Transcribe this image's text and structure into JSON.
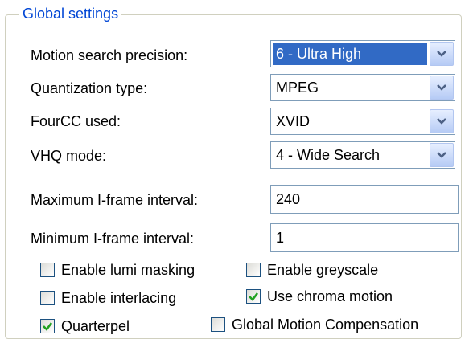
{
  "group": {
    "title": "Global settings"
  },
  "fields": {
    "motion_search": {
      "label": "Motion search precision:",
      "value": "6 - Ultra High"
    },
    "quant_type": {
      "label": "Quantization type:",
      "value": "MPEG"
    },
    "fourcc": {
      "label": "FourCC used:",
      "value": "XVID"
    },
    "vhq": {
      "label": "VHQ mode:",
      "value": "4 - Wide Search"
    },
    "max_iframe": {
      "label": "Maximum I-frame interval:",
      "value": "240"
    },
    "min_iframe": {
      "label": "Minimum I-frame interval:",
      "value": "1"
    }
  },
  "checkboxes": {
    "lumi_masking": {
      "label": "Enable lumi masking",
      "checked": false
    },
    "greyscale": {
      "label": "Enable greyscale",
      "checked": false
    },
    "interlacing": {
      "label": "Enable interlacing",
      "checked": false
    },
    "chroma_motion": {
      "label": "Use chroma motion",
      "checked": true
    },
    "quarterpel": {
      "label": "Quarterpel",
      "checked": true
    },
    "gmc": {
      "label": "Global Motion Compensation",
      "checked": false
    }
  }
}
